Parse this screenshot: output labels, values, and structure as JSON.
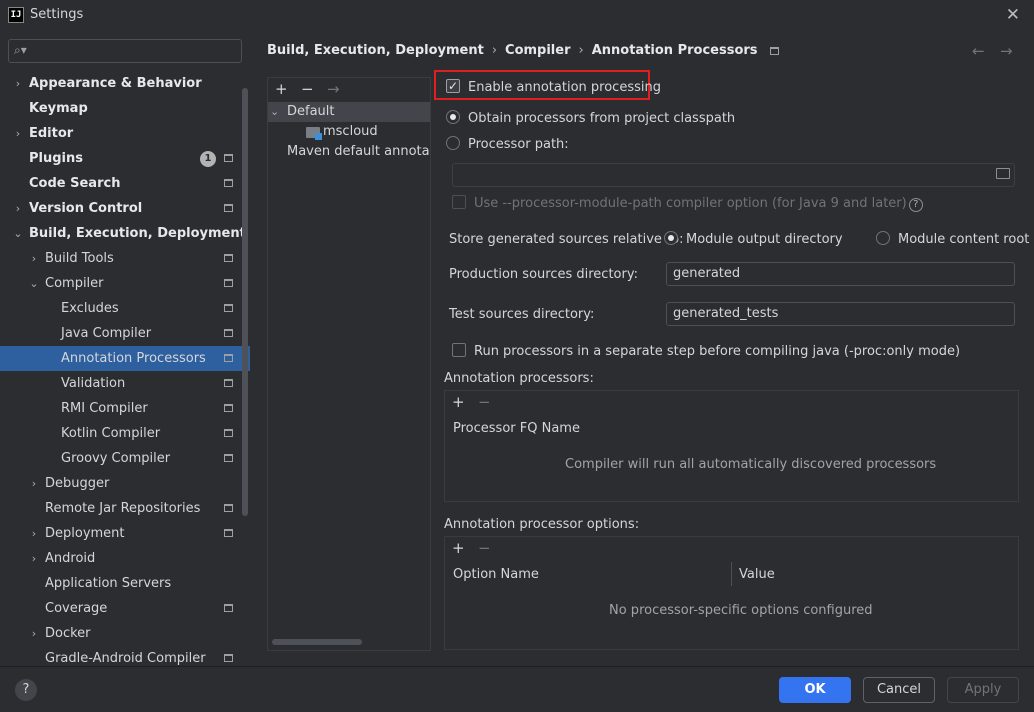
{
  "window": {
    "title": "Settings",
    "app_icon_text": "IJ"
  },
  "search": {
    "placeholder": "",
    "value": ""
  },
  "tree": [
    {
      "label": "Appearance & Behavior",
      "bold": true,
      "chevron": "›",
      "indent": 0
    },
    {
      "label": "Keymap",
      "bold": true,
      "chevron": "",
      "indent": 0
    },
    {
      "label": "Editor",
      "bold": true,
      "chevron": "›",
      "indent": 0
    },
    {
      "label": "Plugins",
      "bold": true,
      "chevron": "",
      "indent": 0,
      "badge": "1",
      "gear": true
    },
    {
      "label": "Code Search",
      "bold": true,
      "chevron": "",
      "indent": 0,
      "gear": true
    },
    {
      "label": "Version Control",
      "bold": true,
      "chevron": "›",
      "indent": 0,
      "gear": true
    },
    {
      "label": "Build, Execution, Deployment",
      "bold": true,
      "chevron": "⌄",
      "indent": 0
    },
    {
      "label": "Build Tools",
      "bold": false,
      "chevron": "›",
      "indent": 1,
      "gear": true
    },
    {
      "label": "Compiler",
      "bold": false,
      "chevron": "⌄",
      "indent": 1,
      "gear": true
    },
    {
      "label": "Excludes",
      "bold": false,
      "chevron": "",
      "indent": 2,
      "gear": true
    },
    {
      "label": "Java Compiler",
      "bold": false,
      "chevron": "",
      "indent": 2,
      "gear": true
    },
    {
      "label": "Annotation Processors",
      "bold": false,
      "chevron": "",
      "indent": 2,
      "gear": true,
      "selected": true
    },
    {
      "label": "Validation",
      "bold": false,
      "chevron": "",
      "indent": 2,
      "gear": true
    },
    {
      "label": "RMI Compiler",
      "bold": false,
      "chevron": "",
      "indent": 2,
      "gear": true
    },
    {
      "label": "Kotlin Compiler",
      "bold": false,
      "chevron": "",
      "indent": 2,
      "gear": true
    },
    {
      "label": "Groovy Compiler",
      "bold": false,
      "chevron": "",
      "indent": 2,
      "gear": true
    },
    {
      "label": "Debugger",
      "bold": false,
      "chevron": "›",
      "indent": 1
    },
    {
      "label": "Remote Jar Repositories",
      "bold": false,
      "chevron": "",
      "indent": 1,
      "gear": true
    },
    {
      "label": "Deployment",
      "bold": false,
      "chevron": "›",
      "indent": 1,
      "gear": true
    },
    {
      "label": "Android",
      "bold": false,
      "chevron": "›",
      "indent": 1
    },
    {
      "label": "Application Servers",
      "bold": false,
      "chevron": "",
      "indent": 1
    },
    {
      "label": "Coverage",
      "bold": false,
      "chevron": "",
      "indent": 1,
      "gear": true
    },
    {
      "label": "Docker",
      "bold": false,
      "chevron": "›",
      "indent": 1
    },
    {
      "label": "Gradle-Android Compiler",
      "bold": false,
      "chevron": "",
      "indent": 1,
      "gear": true
    }
  ],
  "breadcrumb": {
    "items": [
      "Build, Execution, Deployment",
      "Compiler",
      "Annotation Processors"
    ],
    "separator": "›"
  },
  "nav": {
    "back": "←",
    "forward": "→"
  },
  "profiles": {
    "toolbar": {
      "add": "+",
      "remove": "−",
      "move": "→"
    },
    "items": [
      {
        "label": "Default",
        "chevron": "⌄",
        "indent": 0,
        "selected": true
      },
      {
        "label": "mscloud",
        "chevron": "",
        "indent": 1,
        "icon": "module-folder-icon"
      },
      {
        "label": "Maven default annotatio",
        "chevron": "",
        "indent": 0
      }
    ]
  },
  "settings": {
    "enable_annotation_processing": {
      "label": "Enable annotation processing",
      "checked": true
    },
    "obtain_from_classpath": {
      "label": "Obtain processors from project classpath",
      "selected": true
    },
    "processor_path": {
      "label": "Processor path:",
      "selected": false,
      "value": ""
    },
    "module_path_option": {
      "label": "Use --processor-module-path compiler option (for Java 9 and later)",
      "checked": false,
      "disabled": true
    },
    "store_generated": {
      "label": "Store generated sources relative to:",
      "options": [
        {
          "label": "Module output directory",
          "selected": true
        },
        {
          "label": "Module content root",
          "selected": false
        }
      ]
    },
    "production_dir": {
      "label": "Production sources directory:",
      "value": "generated"
    },
    "test_dir": {
      "label": "Test sources directory:",
      "value": "generated_tests"
    },
    "separate_step": {
      "label": "Run processors in a separate step before compiling java (-proc:only mode)",
      "checked": false
    }
  },
  "annotation_processors": {
    "title": "Annotation processors:",
    "toolbar": {
      "add": "+",
      "remove": "−"
    },
    "column": "Processor FQ Name",
    "empty_text": "Compiler will run all automatically discovered processors"
  },
  "processor_options": {
    "title": "Annotation processor options:",
    "toolbar": {
      "add": "+",
      "remove": "−"
    },
    "columns": [
      "Option Name",
      "Value"
    ],
    "empty_text": "No processor-specific options configured"
  },
  "footer": {
    "help": "?",
    "ok": "OK",
    "cancel": "Cancel",
    "apply": "Apply"
  },
  "colors": {
    "background": "#2b2d30",
    "selection": "#2e5f9e",
    "primary_button": "#3574f0",
    "highlight_box": "#e02020"
  }
}
